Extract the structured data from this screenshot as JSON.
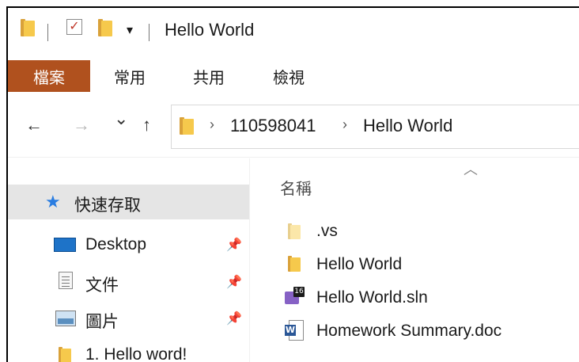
{
  "window": {
    "title": "Hello World",
    "qat_dropdown_glyph": "▾"
  },
  "ribbon": {
    "tabs": [
      {
        "label": "檔案"
      },
      {
        "label": "常用"
      },
      {
        "label": "共用"
      },
      {
        "label": "檢視"
      }
    ]
  },
  "nav": {
    "back_glyph": "←",
    "forward_glyph": "→",
    "recent_glyph": "⌄",
    "up_glyph": "↑",
    "breadcrumb": [
      "110598041",
      "Hello World"
    ],
    "separator_glyph": "›"
  },
  "left_pane": {
    "quick_access": {
      "label": "快速存取",
      "icon": "star-icon"
    },
    "items": [
      {
        "label": "Desktop",
        "icon": "desktop-icon",
        "pinned": true
      },
      {
        "label": "文件",
        "icon": "documents-icon",
        "pinned": true
      },
      {
        "label": "圖片",
        "icon": "pictures-icon",
        "pinned": true
      },
      {
        "label": "1. Hello word!",
        "icon": "folder-icon",
        "pinned": false
      }
    ],
    "pin_glyph": "📌"
  },
  "content": {
    "sort_glyph": "︿",
    "column_name": "名稱",
    "files": [
      {
        "name": ".vs",
        "icon": "folder-icon-hidden"
      },
      {
        "name": "Hello World",
        "icon": "folder-icon"
      },
      {
        "name": "Hello World.sln",
        "icon": "visual-studio-solution-icon",
        "badge": "16"
      },
      {
        "name": "Homework Summary.doc",
        "icon": "word-document-icon",
        "badge": "W"
      }
    ]
  },
  "colors": {
    "file_tab_bg": "#b0511e",
    "selected_bg": "#e5e5e5",
    "folder_yellow": "#f6c94c",
    "vs_purple": "#8661c5",
    "word_blue": "#2b5797"
  }
}
